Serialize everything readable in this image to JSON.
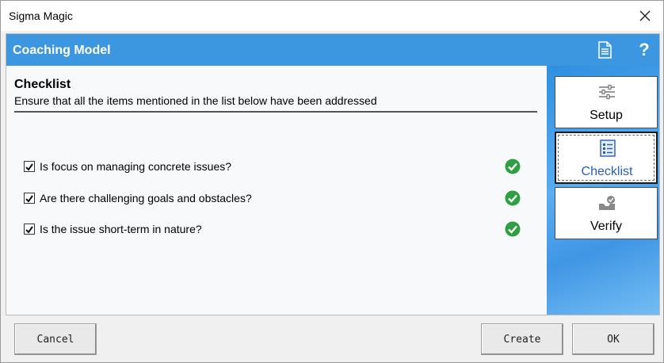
{
  "window": {
    "title": "Sigma Magic"
  },
  "header": {
    "title": "Coaching Model",
    "help_label": "?"
  },
  "section": {
    "title": "Checklist",
    "subtitle": "Ensure that all the items mentioned in the list below have been addressed"
  },
  "checklist": [
    {
      "label": "Is focus on managing concrete issues?",
      "checked": true,
      "status": "check-circle-icon"
    },
    {
      "label": "Are there challenging goals and obstacles?",
      "checked": true,
      "status": "check-circle-icon"
    },
    {
      "label": "Is the issue short-term in nature?",
      "checked": true,
      "status": "check-circle-icon"
    }
  ],
  "nav": {
    "items": [
      {
        "label": "Setup",
        "icon": "sliders-icon",
        "active": false
      },
      {
        "label": "Checklist",
        "icon": "checklist-icon",
        "active": true
      },
      {
        "label": "Verify",
        "icon": "inbox-check-icon",
        "active": false
      }
    ]
  },
  "footer": {
    "cancel_label": "Cancel",
    "create_label": "Create",
    "ok_label": "OK"
  },
  "colors": {
    "header": "#3d96e0",
    "check": "#2ea043",
    "active_nav_text": "#2a5bb8"
  }
}
